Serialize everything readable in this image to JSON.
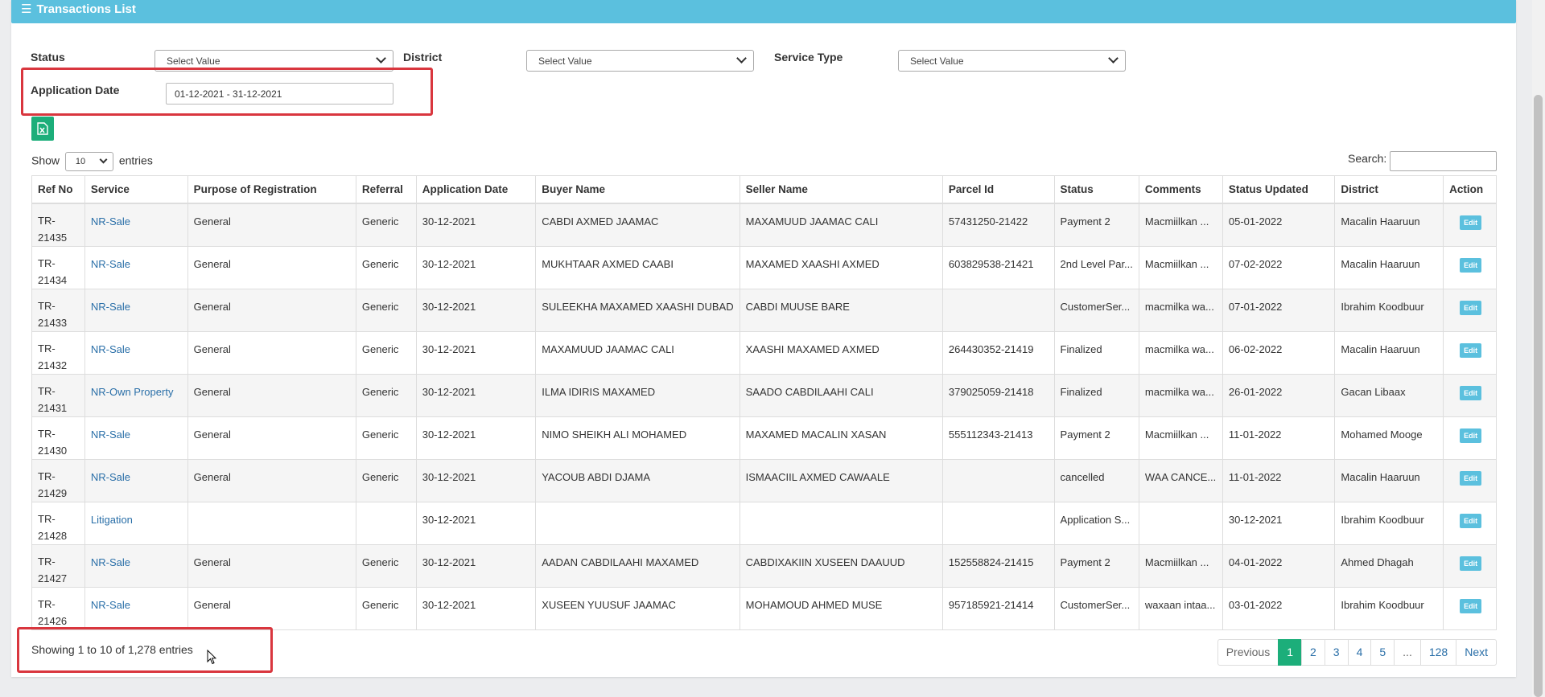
{
  "panel": {
    "title": "Transactions List",
    "header_color": "#5bc0de"
  },
  "filters": {
    "status_label": "Status",
    "status_value": "Select Value",
    "district_label": "District",
    "district_value": "Select Value",
    "service_type_label": "Service Type",
    "service_type_value": "Select Value",
    "application_date_label": "Application Date",
    "application_date_value": "01-12-2021 - 31-12-2021"
  },
  "toolbar": {
    "export_icon": "excel-icon"
  },
  "length": {
    "show_label": "Show",
    "value": "10",
    "entries_label": "entries"
  },
  "search": {
    "label": "Search:",
    "value": ""
  },
  "table": {
    "headers": [
      "Ref No",
      "Service",
      "Purpose of Registration",
      "Referral",
      "Application Date",
      "Buyer Name",
      "Seller Name",
      "Parcel Id",
      "Status",
      "Comments",
      "Status Updated",
      "District",
      "Action"
    ],
    "edit_label": "Edit",
    "rows": [
      {
        "ref": "TR-21435",
        "service": "NR-Sale",
        "purpose": "General",
        "referral": "Generic",
        "app_date": "30-12-2021",
        "buyer": "CABDI AXMED JAAMAC",
        "seller": "MAXAMUUD JAAMAC CALI",
        "parcel": "57431250-21422",
        "status": "Payment 2",
        "comments": "Macmiilkan ...",
        "updated": "05-01-2022",
        "district": "Macalin Haaruun"
      },
      {
        "ref": "TR-21434",
        "service": "NR-Sale",
        "purpose": "General",
        "referral": "Generic",
        "app_date": "30-12-2021",
        "buyer": "MUKHTAAR AXMED CAABI",
        "seller": "MAXAMED XAASHI AXMED",
        "parcel": "603829538-21421",
        "status": "2nd Level Par...",
        "comments": "Macmiilkan ...",
        "updated": "07-02-2022",
        "district": "Macalin Haaruun"
      },
      {
        "ref": "TR-21433",
        "service": "NR-Sale",
        "purpose": "General",
        "referral": "Generic",
        "app_date": "30-12-2021",
        "buyer": "SULEEKHA MAXAMED XAASHI DUBAD",
        "seller": "CABDI MUUSE BARE",
        "parcel": "",
        "status": "CustomerSer...",
        "comments": "macmilka wa...",
        "updated": "07-01-2022",
        "district": "Ibrahim Koodbuur"
      },
      {
        "ref": "TR-21432",
        "service": "NR-Sale",
        "purpose": "General",
        "referral": "Generic",
        "app_date": "30-12-2021",
        "buyer": "MAXAMUUD JAAMAC CALI",
        "seller": "XAASHI MAXAMED AXMED",
        "parcel": "264430352-21419",
        "status": "Finalized",
        "comments": "macmilka wa...",
        "updated": "06-02-2022",
        "district": "Macalin Haaruun"
      },
      {
        "ref": "TR-21431",
        "service": "NR-Own Property",
        "purpose": "General",
        "referral": "Generic",
        "app_date": "30-12-2021",
        "buyer": "ILMA IDIRIS MAXAMED",
        "seller": "SAADO CABDILAAHI CALI",
        "parcel": "379025059-21418",
        "status": "Finalized",
        "comments": "macmilka wa...",
        "updated": "26-01-2022",
        "district": "Gacan Libaax"
      },
      {
        "ref": "TR-21430",
        "service": "NR-Sale",
        "purpose": "General",
        "referral": "Generic",
        "app_date": "30-12-2021",
        "buyer": "NIMO SHEIKH ALI MOHAMED",
        "seller": "MAXAMED MACALIN XASAN",
        "parcel": "555112343-21413",
        "status": "Payment 2",
        "comments": "Macmiilkan ...",
        "updated": "11-01-2022",
        "district": "Mohamed Mooge"
      },
      {
        "ref": "TR-21429",
        "service": "NR-Sale",
        "purpose": "General",
        "referral": "Generic",
        "app_date": "30-12-2021",
        "buyer": "YACOUB ABDI DJAMA",
        "seller": "ISMAACIIL AXMED CAWAALE",
        "parcel": "",
        "status": "cancelled",
        "comments": "WAA CANCE...",
        "updated": "11-01-2022",
        "district": "Macalin Haaruun"
      },
      {
        "ref": "TR-21428",
        "service": "Litigation",
        "purpose": "",
        "referral": "",
        "app_date": "30-12-2021",
        "buyer": "",
        "seller": "",
        "parcel": "",
        "status": "Application S...",
        "comments": "",
        "updated": "30-12-2021",
        "district": "Ibrahim Koodbuur"
      },
      {
        "ref": "TR-21427",
        "service": "NR-Sale",
        "purpose": "General",
        "referral": "Generic",
        "app_date": "30-12-2021",
        "buyer": "AADAN CABDILAAHI MAXAMED",
        "seller": "CABDIXAKIIN XUSEEN DAAUUD",
        "parcel": "152558824-21415",
        "status": "Payment 2",
        "comments": "Macmiilkan ...",
        "updated": "04-01-2022",
        "district": "Ahmed Dhagah"
      },
      {
        "ref": "TR-21426",
        "service": "NR-Sale",
        "purpose": "General",
        "referral": "Generic",
        "app_date": "30-12-2021",
        "buyer": "XUSEEN YUUSUF JAAMAC",
        "seller": "MOHAMOUD AHMED MUSE",
        "parcel": "957185921-21414",
        "status": "CustomerSer...",
        "comments": "waxaan intaa...",
        "updated": "03-01-2022",
        "district": "Ibrahim Koodbuur"
      }
    ]
  },
  "footer": {
    "info": "Showing 1 to 10 of 1,278 entries",
    "pagination": {
      "previous": "Previous",
      "pages": [
        "1",
        "2",
        "3",
        "4",
        "5",
        "...",
        "128"
      ],
      "active": "1",
      "next": "Next"
    }
  },
  "colors": {
    "accent": "#1cae7a",
    "highlight": "#d9363e",
    "link": "#2a6fa8"
  }
}
